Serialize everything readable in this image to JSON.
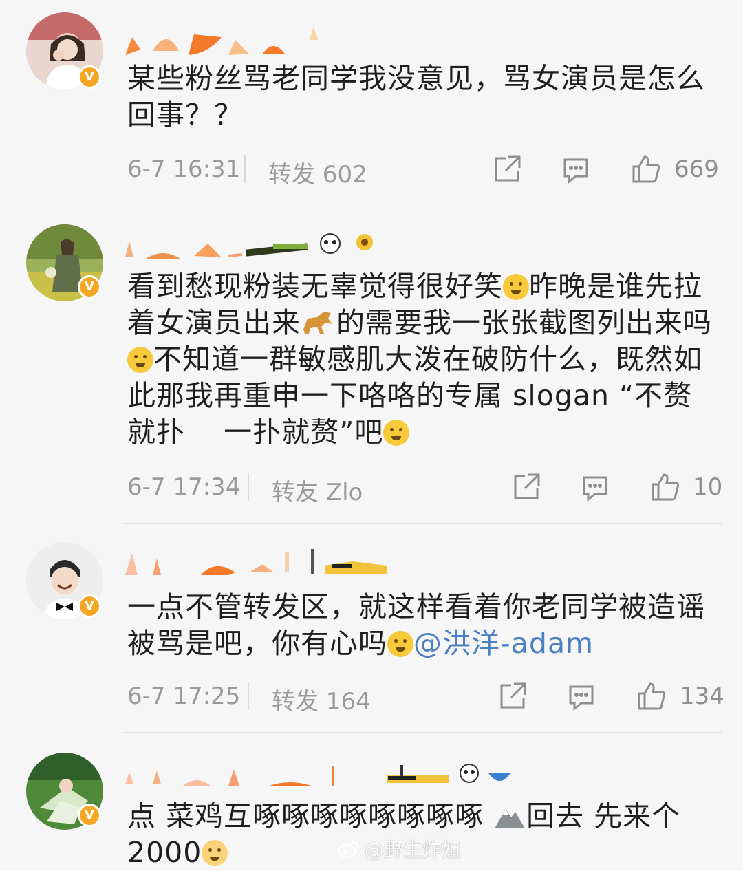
{
  "posts": [
    {
      "text": "某些粉丝骂老同学我没意见，骂女演员是怎么回事？？",
      "time": "6-7 16:31",
      "repost_label": "转发 602",
      "likes": "669"
    },
    {
      "text_parts": [
        "看到愁现粉装无辜觉得很好笑",
        "昨晚是谁先拉着女演员出来",
        "的需要我一张张截图列出来吗",
        "不知道一群敏感肌大泼在破防什么，既然如此那我再重申一下咯咯的专属 slogan “不赘就扑",
        "一扑就赘”吧"
      ],
      "time": "6-7 17:34",
      "repost_label": "转友 Zlo",
      "likes": "10"
    },
    {
      "text": "一点不管转发区，就这样看着你老同学被造谣被骂是吧，你有心吗",
      "mention": "@洪洋-adam",
      "time": "6-7 17:25",
      "repost_label": "转发 164",
      "likes": "134"
    },
    {
      "text_parts": [
        "点 菜鸡互啄啄啄啄啄啄啄啄 ",
        "回去 先来个 2000"
      ]
    }
  ],
  "verified_badge": "V",
  "watermark": "@野生炸姐",
  "icons": {
    "share": "share-icon",
    "comment": "comment-icon",
    "like": "thumbs-up-icon"
  },
  "colors": {
    "verified": "#f5a623",
    "mention": "#4a80c2",
    "meta_text": "#9a9a9a"
  }
}
